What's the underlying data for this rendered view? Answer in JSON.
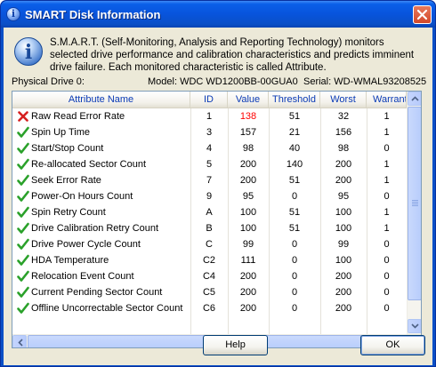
{
  "window": {
    "title": "SMART Disk Information"
  },
  "info": {
    "text": "S.M.A.R.T. (Self-Monitoring, Analysis and Reporting Technology) monitors selected drive performance and calibration characteristics and predicts imminent drive failure. Each monitored characteristic is called Attribute."
  },
  "drive": {
    "physical": "Physical Drive 0:",
    "model": "Model: WDC WD1200BB-00GUA0",
    "serial": "Serial: WD-WMAL93208525"
  },
  "table": {
    "columns": [
      "Attribute Name",
      "ID",
      "Value",
      "Threshold",
      "Worst",
      "Warrant"
    ],
    "rows": [
      {
        "status": "fail",
        "name": "Raw Read Error Rate",
        "id": "1",
        "value": "138",
        "threshold": "51",
        "worst": "32",
        "warrant": "1"
      },
      {
        "status": "ok",
        "name": "Spin Up Time",
        "id": "3",
        "value": "157",
        "threshold": "21",
        "worst": "156",
        "warrant": "1"
      },
      {
        "status": "ok",
        "name": "Start/Stop Count",
        "id": "4",
        "value": "98",
        "threshold": "40",
        "worst": "98",
        "warrant": "0"
      },
      {
        "status": "ok",
        "name": "Re-allocated Sector Count",
        "id": "5",
        "value": "200",
        "threshold": "140",
        "worst": "200",
        "warrant": "1"
      },
      {
        "status": "ok",
        "name": "Seek Error Rate",
        "id": "7",
        "value": "200",
        "threshold": "51",
        "worst": "200",
        "warrant": "1"
      },
      {
        "status": "ok",
        "name": "Power-On Hours Count",
        "id": "9",
        "value": "95",
        "threshold": "0",
        "worst": "95",
        "warrant": "0"
      },
      {
        "status": "ok",
        "name": "Spin Retry Count",
        "id": "A",
        "value": "100",
        "threshold": "51",
        "worst": "100",
        "warrant": "1"
      },
      {
        "status": "ok",
        "name": "Drive Calibration Retry Count",
        "id": "B",
        "value": "100",
        "threshold": "51",
        "worst": "100",
        "warrant": "1"
      },
      {
        "status": "ok",
        "name": "Drive Power Cycle Count",
        "id": "C",
        "value": "99",
        "threshold": "0",
        "worst": "99",
        "warrant": "0"
      },
      {
        "status": "ok",
        "name": "HDA Temperature",
        "id": "C2",
        "value": "111",
        "threshold": "0",
        "worst": "100",
        "warrant": "0"
      },
      {
        "status": "ok",
        "name": "Relocation Event Count",
        "id": "C4",
        "value": "200",
        "threshold": "0",
        "worst": "200",
        "warrant": "0"
      },
      {
        "status": "ok",
        "name": "Current Pending Sector Count",
        "id": "C5",
        "value": "200",
        "threshold": "0",
        "worst": "200",
        "warrant": "0"
      },
      {
        "status": "ok",
        "name": "Offline Uncorrectable Sector Count",
        "id": "C6",
        "value": "200",
        "threshold": "0",
        "worst": "200",
        "warrant": "0"
      }
    ]
  },
  "buttons": {
    "help": "Help",
    "ok": "OK"
  },
  "colors": {
    "fail_value": "#ff0000",
    "header_text": "#0a3ab5",
    "ok_check": "#2aa12a",
    "fail_x": "#d62020"
  },
  "icons": {
    "title": "info-icon",
    "close": "close-icon",
    "message": "info-icon",
    "ok": "checkmark-icon",
    "fail": "red-x-icon"
  }
}
